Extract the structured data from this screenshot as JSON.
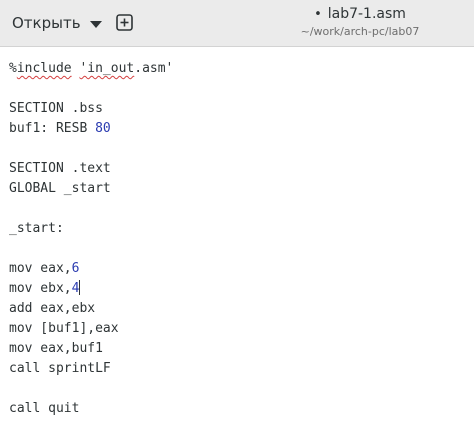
{
  "header": {
    "open_label": "Открыть",
    "chevron_icon": "chevron-down-icon",
    "new_tab_icon": "plus-in-square-icon",
    "modified_marker": "•",
    "title": "lab7-1.asm",
    "subtitle": "~/work/arch-pc/lab07"
  },
  "editor": {
    "lines": {
      "l1": {
        "prefix": "%",
        "squiggle_a": "include",
        "space": " ",
        "squiggle_b": "'in_out",
        "suffix": ".asm'"
      },
      "l3": "SECTION .bss",
      "l4": {
        "text": "buf1: RESB ",
        "num": "80"
      },
      "l6": "SECTION .text",
      "l7": "GLOBAL _start",
      "l9": "_start:",
      "l11": {
        "text": "mov eax,",
        "num": "6"
      },
      "l12": {
        "text": "mov ebx,",
        "num": "4"
      },
      "l13": "add eax,ebx",
      "l14": "mov [buf1],eax",
      "l15": "mov eax,buf1",
      "l16": "call sprintLF",
      "l18": "call quit"
    },
    "colors": {
      "number": "#2a3bb0",
      "spell_error": "#d43f3f"
    }
  }
}
